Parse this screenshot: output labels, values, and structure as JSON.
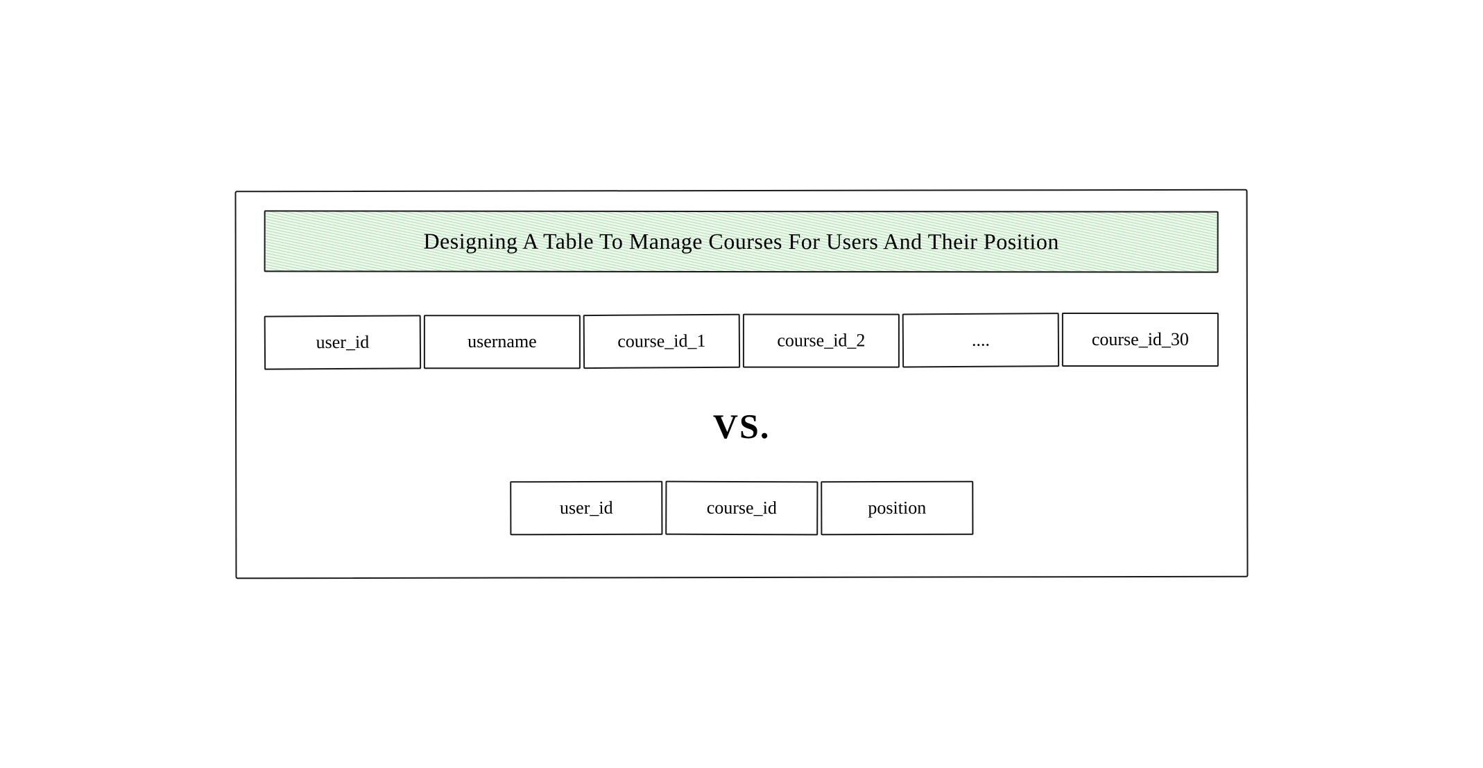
{
  "title": "Designing A Table To Manage Courses For Users And Their Position",
  "wide_row": {
    "cells": [
      {
        "label": "user_id"
      },
      {
        "label": "username"
      },
      {
        "label": "course_id_1"
      },
      {
        "label": "course_id_2"
      },
      {
        "label": "...."
      },
      {
        "label": "course_id_30"
      }
    ]
  },
  "vs_label": "VS.",
  "narrow_row": {
    "cells": [
      {
        "label": "user_id"
      },
      {
        "label": "course_id"
      },
      {
        "label": "position"
      }
    ]
  }
}
